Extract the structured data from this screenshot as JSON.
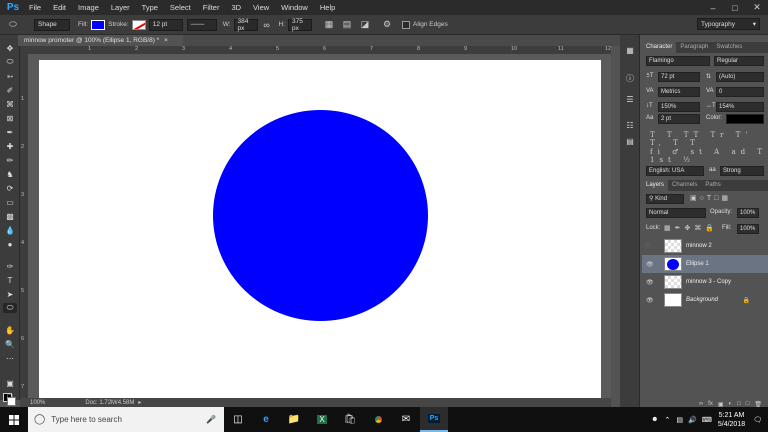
{
  "menubar": {
    "logo": "Ps",
    "items": [
      "File",
      "Edit",
      "Image",
      "Layer",
      "Type",
      "Select",
      "Filter",
      "3D",
      "View",
      "Window",
      "Help"
    ]
  },
  "options": {
    "mode": "Shape",
    "fill_label": "Fill:",
    "stroke_label": "Stroke:",
    "stroke_width": "12 pt",
    "w_label": "W:",
    "w_value": "384 px",
    "h_label": "H:",
    "h_value": "375 px",
    "align_edges": "Align Edges",
    "workspace": "Typography",
    "fill_color": "#0000ff"
  },
  "document": {
    "tab_title": "minnow promoter @ 100% (Ellipse 1, RGB/8) *",
    "ruler_h": [
      "1",
      "2",
      "3",
      "4",
      "5",
      "6",
      "7",
      "8",
      "9",
      "10",
      "11",
      "12"
    ],
    "ruler_v": [
      "1",
      "2",
      "3",
      "4",
      "5",
      "6",
      "7"
    ],
    "ellipse_color": "#0000ff"
  },
  "status": {
    "zoom": "100%",
    "doc": "Doc: 1.72M/4.58M"
  },
  "character": {
    "tabs": [
      "Character",
      "Paragraph",
      "Swatches"
    ],
    "font_family": "Flamingo",
    "font_style": "Regular",
    "size": "72 pt",
    "leading": "(Auto)",
    "kerning": "Metrics",
    "tracking": "0",
    "vscale": "150%",
    "hscale": "154%",
    "baseline": "2 pt",
    "color_label": "Color:",
    "glyphs_row1": "T T TT Tr T' T, T T",
    "glyphs_row2": "fi ♂ st A ad T 1st ½",
    "language": "English: USA",
    "aa_prefix": "aa",
    "antialias": "Strong"
  },
  "layers": {
    "tabs": [
      "Layers",
      "Channels",
      "Paths"
    ],
    "filter": "Kind",
    "blend": "Normal",
    "opacity_label": "Opacity:",
    "opacity": "100%",
    "lock_label": "Lock:",
    "fill_label": "Fill:",
    "fill": "100%",
    "items": [
      {
        "name": "minnow 2",
        "visible": false
      },
      {
        "name": "Ellipse 1",
        "visible": true,
        "selected": true
      },
      {
        "name": "minnow 3 - Copy",
        "visible": true
      },
      {
        "name": "Background",
        "visible": true
      }
    ]
  },
  "taskbar": {
    "search_placeholder": "Type here to search",
    "time": "5:21 AM",
    "date": "5/4/2018"
  }
}
